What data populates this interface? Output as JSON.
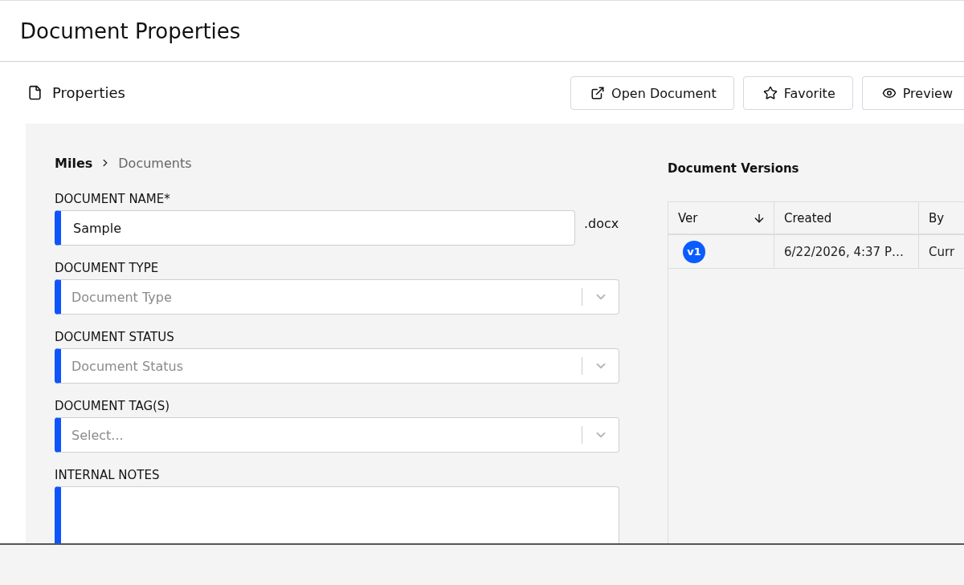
{
  "page": {
    "title": "Document Properties"
  },
  "toolbar": {
    "section_title": "Properties",
    "buttons": [
      {
        "kind": "open",
        "label": "Open Document"
      },
      {
        "kind": "favorite",
        "label": "Favorite"
      },
      {
        "kind": "preview",
        "label": "Preview"
      }
    ]
  },
  "breadcrumb": [
    {
      "label": "Miles",
      "current": false
    },
    {
      "label": "Documents",
      "current": true
    }
  ],
  "form": {
    "fields": [
      {
        "kind": "text",
        "label": "DOCUMENT NAME*",
        "value": "Sample",
        "suffix": ".docx"
      },
      {
        "kind": "select",
        "label": "DOCUMENT TYPE",
        "placeholder": "Document Type"
      },
      {
        "kind": "select",
        "label": "DOCUMENT STATUS",
        "placeholder": "Document Status"
      },
      {
        "kind": "select",
        "label": "DOCUMENT TAG(S)",
        "placeholder": "Select..."
      },
      {
        "kind": "textarea",
        "label": "INTERNAL NOTES"
      }
    ]
  },
  "versions": {
    "title": "Document Versions",
    "columns": [
      {
        "label": "Ver",
        "sorted": true
      },
      {
        "label": "Created",
        "sorted": false
      },
      {
        "label": "By",
        "sorted": false
      }
    ],
    "rows": [
      {
        "version": "v1",
        "created": "6/22/2026, 4:37 P…",
        "by": "Curr"
      }
    ]
  }
}
